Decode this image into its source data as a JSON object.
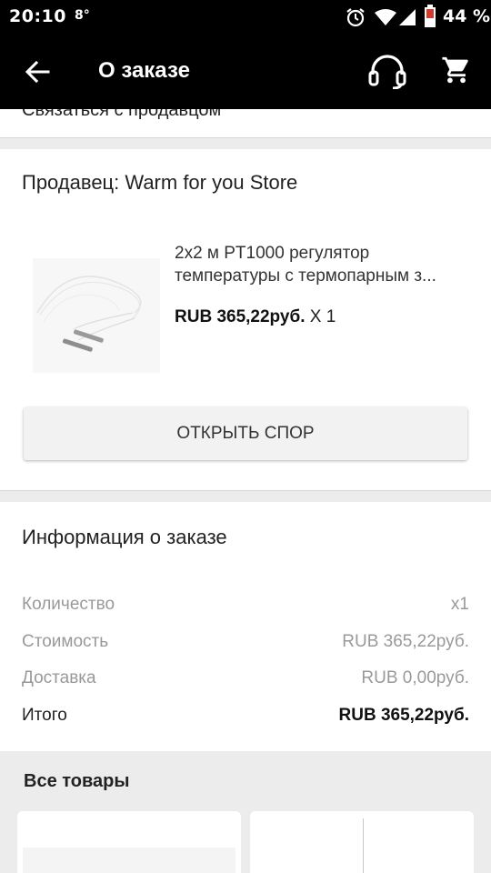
{
  "status_bar": {
    "time": "20:10",
    "temperature": "8°",
    "battery": "44 %"
  },
  "app_bar": {
    "title": "О заказе",
    "icons": [
      "back-arrow-icon",
      "headset-icon",
      "shopping-cart-icon"
    ]
  },
  "contact_strip": {
    "label": "Связаться с продавцом"
  },
  "seller": {
    "title": "Продавец: Warm for you Store",
    "product": {
      "name_line1": "2x2 м PT1000 регулятор",
      "name_line2": "температуры с термопарным з...",
      "price": "RUB 365,22руб.",
      "quantity": "X 1"
    },
    "dispute_button": "ОТКРЫТЬ СПОР"
  },
  "order_info": {
    "title": "Информация о заказе",
    "rows": [
      {
        "label": "Количество",
        "value": "x1"
      },
      {
        "label": "Стоимость",
        "value": "RUB 365,22руб."
      },
      {
        "label": "Доставка",
        "value": "RUB 0,00руб."
      },
      {
        "label": "Итого",
        "value": "RUB 365,22руб."
      }
    ]
  },
  "all_goods": {
    "title": "Все товары"
  },
  "colors": {
    "bar_bg": "#000000",
    "page_bg": "#ececec",
    "card_bg": "#ffffff",
    "muted_text": "#999999"
  }
}
